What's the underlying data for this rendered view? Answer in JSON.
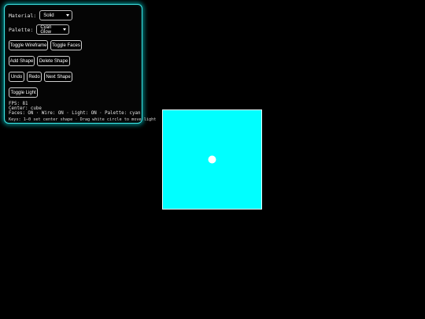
{
  "controls": {
    "material": {
      "label": "Material:",
      "value": "Solid"
    },
    "palette": {
      "label": "Palette:",
      "value": "Cyan Glow"
    },
    "buttons": {
      "toggle_wireframe": "Toggle Wireframe",
      "toggle_faces": "Toggle Faces",
      "add_shape": "Add Shape",
      "delete_shape": "Delete Shape",
      "undo": "Undo",
      "redo": "Redo",
      "next_shape": "Next Shape",
      "toggle_light": "Toggle Light"
    }
  },
  "status": {
    "fps": "FPS: 81",
    "center": "Center: cube",
    "flags": "Faces: ON · Wire: ON · Light: ON · Palette: cyan",
    "keys_hint": "Keys: 1–0 set center shape · Drag white circle to move light"
  },
  "scene": {
    "shape": "cube",
    "face_color": "#00ffff",
    "wire_color": "#e8ffff",
    "light_handle_color": "#ffffff",
    "background": "#000000"
  }
}
